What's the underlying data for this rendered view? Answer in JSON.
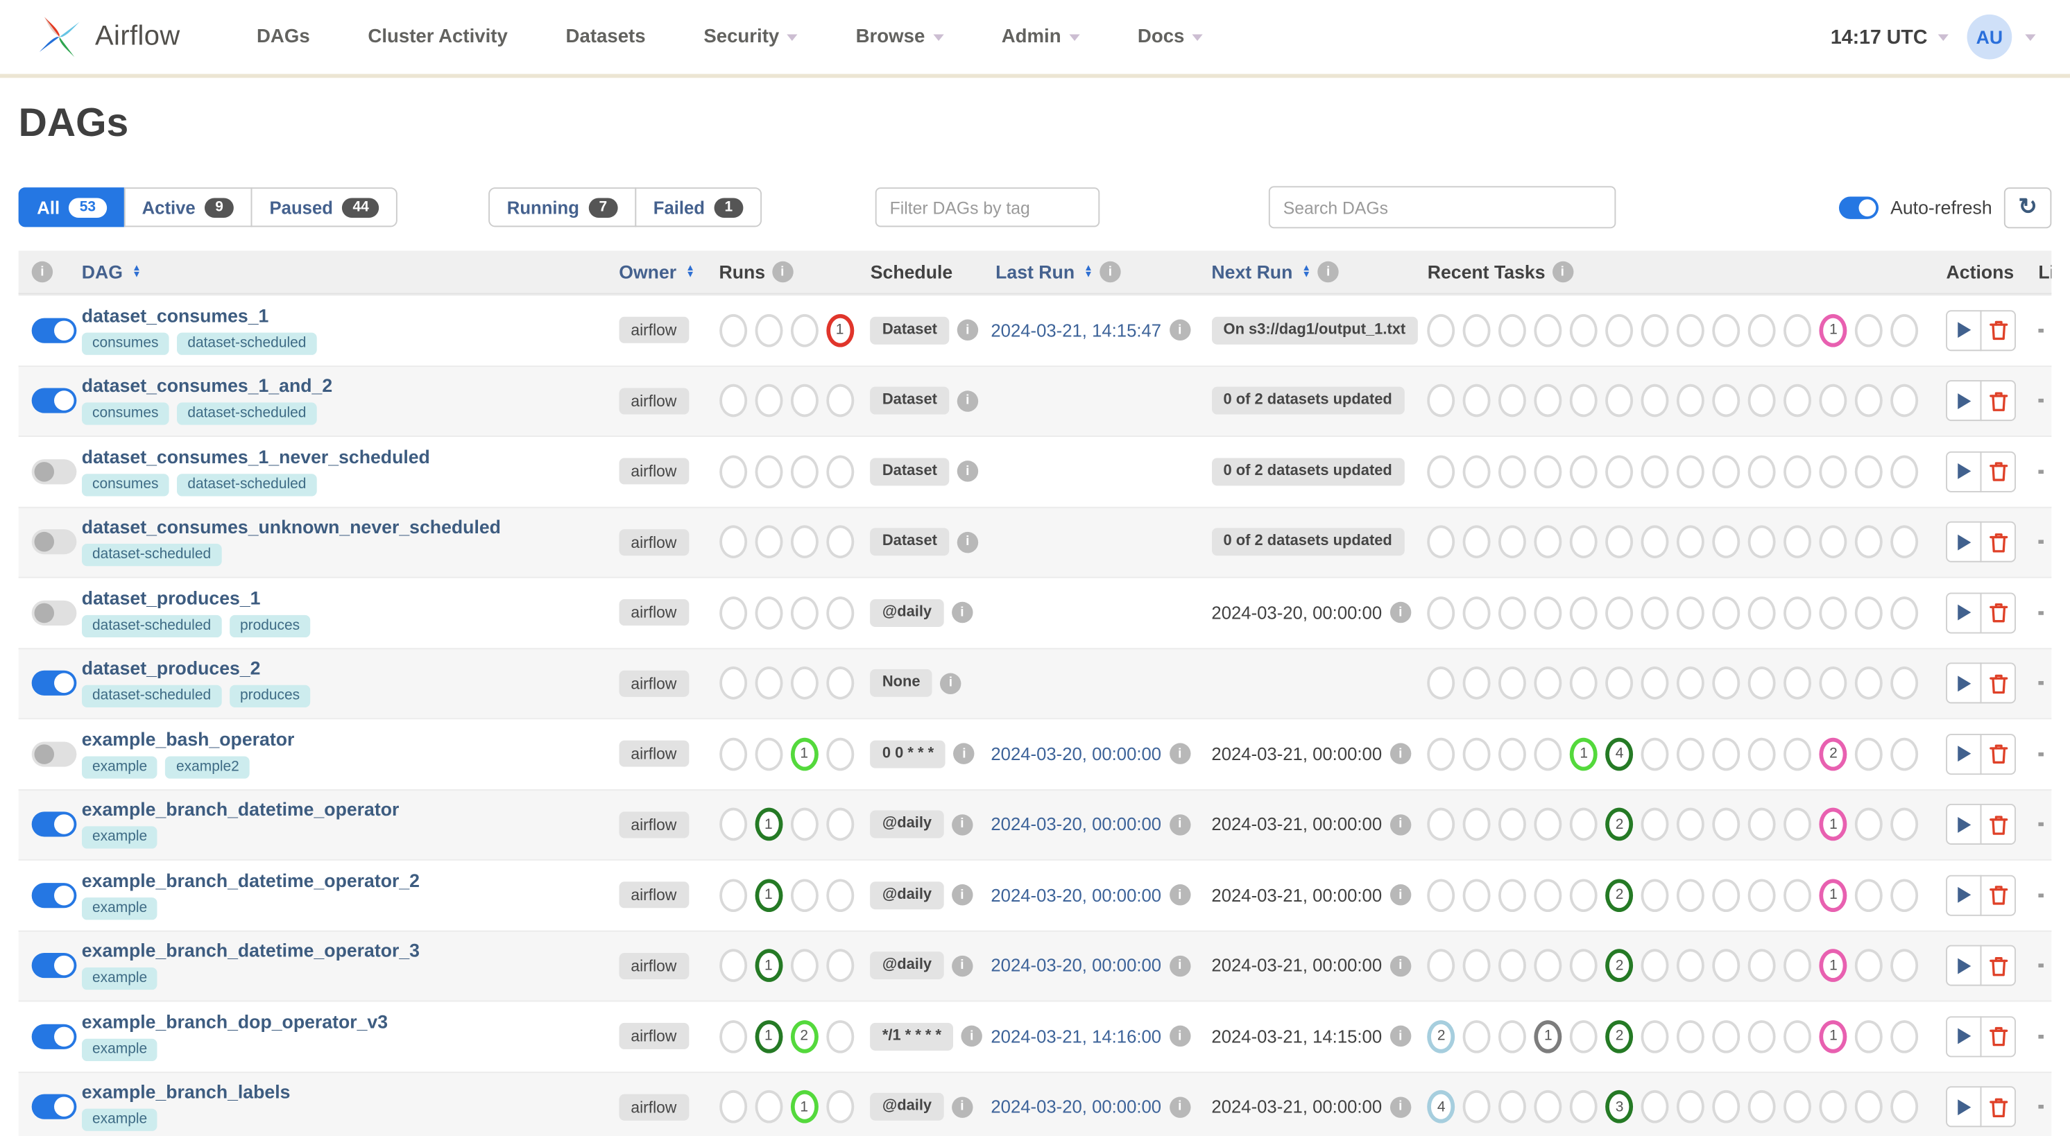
{
  "nav": {
    "brand": "Airflow",
    "items": [
      {
        "label": "DAGs",
        "caret": false
      },
      {
        "label": "Cluster Activity",
        "caret": false
      },
      {
        "label": "Datasets",
        "caret": false
      },
      {
        "label": "Security",
        "caret": true
      },
      {
        "label": "Browse",
        "caret": true
      },
      {
        "label": "Admin",
        "caret": true
      },
      {
        "label": "Docs",
        "caret": true
      }
    ],
    "clock": "14:17 UTC",
    "avatar": "AU"
  },
  "page": {
    "title": "DAGs"
  },
  "filters": {
    "groups": [
      [
        {
          "label": "All",
          "count": "53",
          "active": true
        },
        {
          "label": "Active",
          "count": "9",
          "active": false
        },
        {
          "label": "Paused",
          "count": "44",
          "active": false
        }
      ],
      [
        {
          "label": "Running",
          "count": "7",
          "active": false
        },
        {
          "label": "Failed",
          "count": "1",
          "active": false
        }
      ]
    ],
    "tag_placeholder": "Filter DAGs by tag",
    "search_placeholder": "Search DAGs",
    "auto_refresh_label": "Auto-refresh",
    "auto_refresh_on": true,
    "refresh_icon": "refresh-icon"
  },
  "colors": {
    "accent": "#2577e3",
    "state_none": "#a6cede",
    "state_queued": "#7d7d7d",
    "state_running": "#54d93c",
    "state_success": "#257a25",
    "state_failed": "#e0352b",
    "state_skipped": "#e860b0",
    "circle_empty": "#d9d9d9"
  },
  "table": {
    "headers": [
      {
        "label": "",
        "info": true,
        "blue": false,
        "cls": "c-toggle"
      },
      {
        "label": "DAG",
        "sort": true,
        "blue": true,
        "cls": "c-dag-h"
      },
      {
        "label": "Owner",
        "sort": true,
        "blue": true,
        "cls": "c-owner"
      },
      {
        "label": "Runs",
        "info": true,
        "blue": false,
        "cls": "c-runs"
      },
      {
        "label": "Schedule",
        "blue": false,
        "cls": "c-sched"
      },
      {
        "label": "Last Run",
        "sort": true,
        "info": true,
        "blue": true,
        "cls": "c-last-h"
      },
      {
        "label": "Next Run",
        "sort": true,
        "info": true,
        "blue": true,
        "cls": "c-next"
      },
      {
        "label": "Recent Tasks",
        "info": true,
        "blue": false,
        "cls": "c-recent"
      },
      {
        "label": "Actions",
        "blue": false,
        "cls": "c-actions"
      },
      {
        "label": "Links",
        "blue": false,
        "cls": "c-links"
      }
    ],
    "run_states": [
      "queued",
      "success",
      "running",
      "failed"
    ],
    "task_states": [
      "none",
      "removed",
      "scheduled",
      "queued",
      "running",
      "success",
      "restarting",
      "failed",
      "up_for_retry",
      "up_for_reschedule",
      "upstream_failed",
      "skipped",
      "deferred",
      "shutdown"
    ],
    "rows": [
      {
        "name": "dataset_consumes_1",
        "tags": [
          "consumes",
          "dataset-scheduled"
        ],
        "enabled": true,
        "owner": "airflow",
        "runs": {
          "failed": 1
        },
        "schedule": "Dataset",
        "last_run": "2024-03-21, 14:15:47",
        "next_run": {
          "badge": "On s3://dag1/output_1.txt"
        },
        "recent": {
          "skipped": 1
        }
      },
      {
        "name": "dataset_consumes_1_and_2",
        "tags": [
          "consumes",
          "dataset-scheduled"
        ],
        "enabled": true,
        "owner": "airflow",
        "runs": {},
        "schedule": "Dataset",
        "last_run": null,
        "next_run": {
          "badge": "0 of 2 datasets updated"
        },
        "recent": {}
      },
      {
        "name": "dataset_consumes_1_never_scheduled",
        "tags": [
          "consumes",
          "dataset-scheduled"
        ],
        "enabled": false,
        "owner": "airflow",
        "runs": {},
        "schedule": "Dataset",
        "last_run": null,
        "next_run": {
          "badge": "0 of 2 datasets updated"
        },
        "recent": {}
      },
      {
        "name": "dataset_consumes_unknown_never_scheduled",
        "tags": [
          "dataset-scheduled"
        ],
        "enabled": false,
        "owner": "airflow",
        "runs": {},
        "schedule": "Dataset",
        "last_run": null,
        "next_run": {
          "badge": "0 of 2 datasets updated"
        },
        "recent": {}
      },
      {
        "name": "dataset_produces_1",
        "tags": [
          "dataset-scheduled",
          "produces"
        ],
        "enabled": false,
        "owner": "airflow",
        "runs": {},
        "schedule": "@daily",
        "last_run": null,
        "next_run": {
          "text": "2024-03-20, 00:00:00"
        },
        "recent": {}
      },
      {
        "name": "dataset_produces_2",
        "tags": [
          "dataset-scheduled",
          "produces"
        ],
        "enabled": true,
        "owner": "airflow",
        "runs": {},
        "schedule": "None",
        "last_run": null,
        "next_run": null,
        "recent": {}
      },
      {
        "name": "example_bash_operator",
        "tags": [
          "example",
          "example2"
        ],
        "enabled": false,
        "owner": "airflow",
        "runs": {
          "running": 1
        },
        "schedule": "0 0 * * *",
        "last_run": "2024-03-20, 00:00:00",
        "next_run": {
          "text": "2024-03-21, 00:00:00"
        },
        "recent": {
          "running": 1,
          "success": 4,
          "skipped": 2
        }
      },
      {
        "name": "example_branch_datetime_operator",
        "tags": [
          "example"
        ],
        "enabled": true,
        "owner": "airflow",
        "runs": {
          "success": 1
        },
        "schedule": "@daily",
        "last_run": "2024-03-20, 00:00:00",
        "next_run": {
          "text": "2024-03-21, 00:00:00"
        },
        "recent": {
          "success": 2,
          "skipped": 1
        }
      },
      {
        "name": "example_branch_datetime_operator_2",
        "tags": [
          "example"
        ],
        "enabled": true,
        "owner": "airflow",
        "runs": {
          "success": 1
        },
        "schedule": "@daily",
        "last_run": "2024-03-20, 00:00:00",
        "next_run": {
          "text": "2024-03-21, 00:00:00"
        },
        "recent": {
          "success": 2,
          "skipped": 1
        }
      },
      {
        "name": "example_branch_datetime_operator_3",
        "tags": [
          "example"
        ],
        "enabled": true,
        "owner": "airflow",
        "runs": {
          "success": 1
        },
        "schedule": "@daily",
        "last_run": "2024-03-20, 00:00:00",
        "next_run": {
          "text": "2024-03-21, 00:00:00"
        },
        "recent": {
          "success": 2,
          "skipped": 1
        }
      },
      {
        "name": "example_branch_dop_operator_v3",
        "tags": [
          "example"
        ],
        "enabled": true,
        "owner": "airflow",
        "runs": {
          "success": 1,
          "running": 2
        },
        "schedule": "*/1 * * * *",
        "last_run": "2024-03-21, 14:16:00",
        "next_run": {
          "text": "2024-03-21, 14:15:00"
        },
        "recent": {
          "none": 2,
          "queued": 1,
          "success": 2,
          "skipped": 1
        }
      },
      {
        "name": "example_branch_labels",
        "tags": [
          "example"
        ],
        "enabled": true,
        "owner": "airflow",
        "runs": {
          "running": 1
        },
        "schedule": "@daily",
        "last_run": "2024-03-20, 00:00:00",
        "next_run": {
          "text": "2024-03-21, 00:00:00"
        },
        "recent": {
          "none": 4,
          "success": 3
        }
      }
    ]
  }
}
